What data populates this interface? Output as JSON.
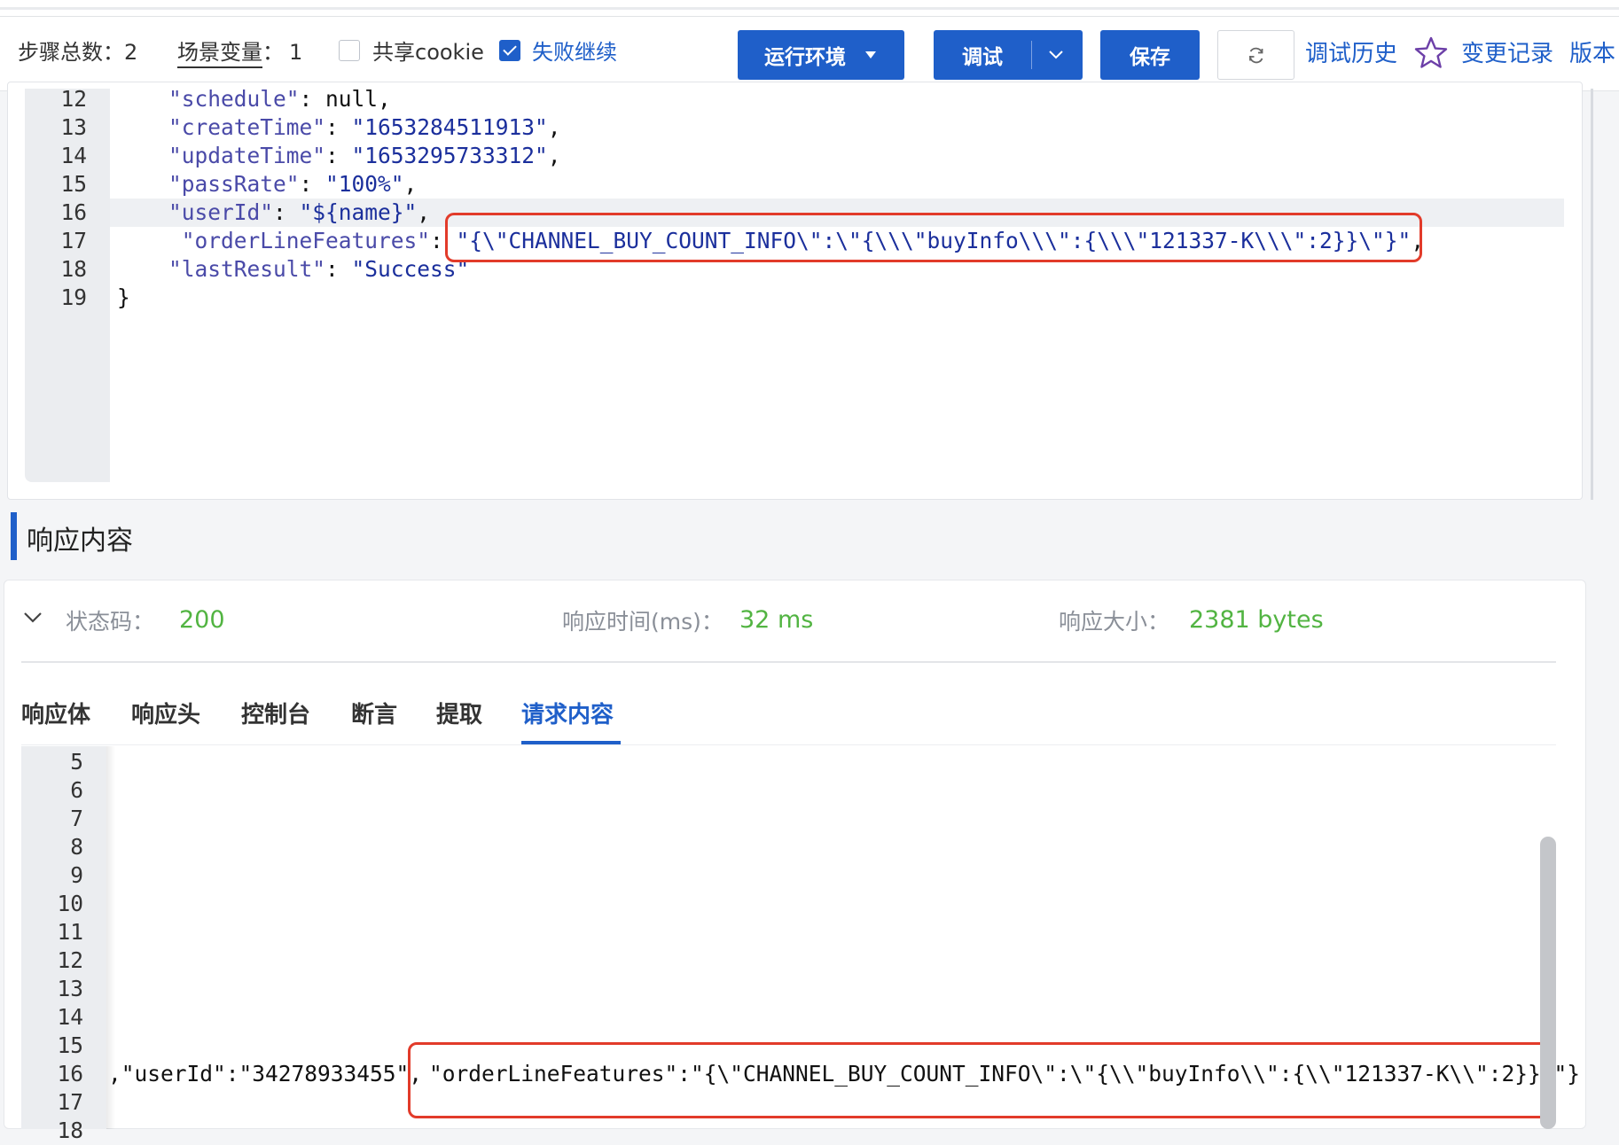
{
  "toolbar": {
    "steps_label": "步骤总数：",
    "steps_value": "2",
    "scene_vars_label": "场景变量",
    "scene_vars_sep": "：",
    "scene_vars_value": "1",
    "share_cookie_label": "共享cookie",
    "share_cookie_checked": false,
    "fail_continue_label": "失败继续",
    "fail_continue_checked": true,
    "run_env_label": "运行环境",
    "debug_label": "调试",
    "save_label": "保存",
    "debug_history_label": "调试历史",
    "change_log_label": "变更记录",
    "version_label": "版本"
  },
  "editor_top": {
    "line_numbers": [
      "12",
      "13",
      "14",
      "15",
      "16",
      "17",
      "18",
      "19"
    ],
    "active_line": "16",
    "lines": [
      [
        {
          "t": "key",
          "v": "\"schedule\""
        },
        {
          "t": "punc",
          "v": ": "
        },
        {
          "t": "null",
          "v": "null"
        },
        {
          "t": "punc",
          "v": ","
        }
      ],
      [
        {
          "t": "key",
          "v": "\"createTime\""
        },
        {
          "t": "punc",
          "v": ": "
        },
        {
          "t": "str",
          "v": "\"1653284511913\""
        },
        {
          "t": "punc",
          "v": ","
        }
      ],
      [
        {
          "t": "key",
          "v": "\"updateTime\""
        },
        {
          "t": "punc",
          "v": ": "
        },
        {
          "t": "str",
          "v": "\"1653295733312\""
        },
        {
          "t": "punc",
          "v": ","
        }
      ],
      [
        {
          "t": "key",
          "v": "\"passRate\""
        },
        {
          "t": "punc",
          "v": ": "
        },
        {
          "t": "str",
          "v": "\"100%\""
        },
        {
          "t": "punc",
          "v": ","
        }
      ],
      [
        {
          "t": "key",
          "v": "\"userId\""
        },
        {
          "t": "punc",
          "v": ": "
        },
        {
          "t": "str",
          "v": "\"${name}\""
        },
        {
          "t": "punc",
          "v": ","
        }
      ],
      [
        {
          "t": "key",
          "v": " \"orderLineFeatures\""
        },
        {
          "t": "punc",
          "v": ": "
        },
        {
          "t": "str",
          "v": "\"{\\\"CHANNEL_BUY_COUNT_INFO\\\":\\\"{\\\\\\\"buyInfo\\\\\\\":{\\\\\\\"121337-K\\\\\\\":2}}\\\"}\""
        },
        {
          "t": "punc",
          "v": ","
        }
      ],
      [
        {
          "t": "key",
          "v": "\"lastResult\""
        },
        {
          "t": "punc",
          "v": ": "
        },
        {
          "t": "str",
          "v": "\"Success\""
        }
      ],
      [
        {
          "t": "punc",
          "v": "}"
        }
      ]
    ]
  },
  "response": {
    "section_title": "响应内容",
    "status_label": "状态码：",
    "status_value": "200",
    "time_label": "响应时间(ms)：",
    "time_value": "32 ms",
    "size_label": "响应大小：",
    "size_value": "2381 bytes",
    "tabs": [
      "响应体",
      "响应头",
      "控制台",
      "断言",
      "提取",
      "请求内容"
    ],
    "active_tab": "请求内容"
  },
  "editor_bottom": {
    "line_numbers": [
      "5",
      "6",
      "7",
      "8",
      "9",
      "10",
      "11",
      "12",
      "13",
      "14",
      "15",
      "16",
      "17",
      "18"
    ],
    "line16_prefix": ",\"userId\":\"34278933455\",",
    "line16_highlight": "\"orderLineFeatures\":\"{\\\"CHANNEL_BUY_COUNT_INFO\\\":\\\"{\\\\\"buyInfo\\\\\":{\\\\\"121337-K\\\\\":2}}\\\"}"
  },
  "colors": {
    "accent": "#1f5fc9",
    "highlight_border": "#e23b2a",
    "success_value": "#52b442"
  }
}
